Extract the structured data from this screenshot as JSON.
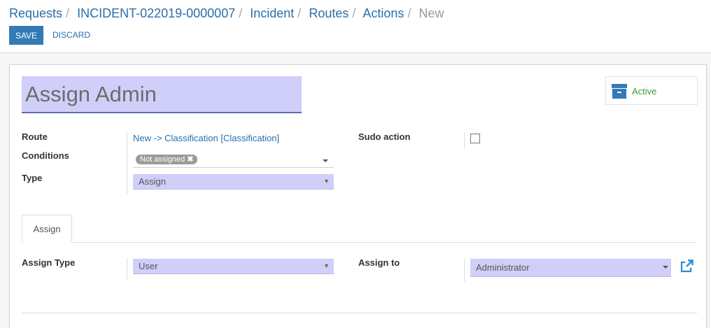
{
  "breadcrumb": {
    "items": [
      "Requests",
      "INCIDENT-022019-0000007",
      "Incident",
      "Routes",
      "Actions"
    ],
    "current": "New"
  },
  "toolbar": {
    "save_label": "SAVE",
    "discard_label": "DISCARD"
  },
  "record": {
    "title": "Assign Admin",
    "active_label": "Active",
    "active_icon": "archive-icon"
  },
  "fields": {
    "route": {
      "label": "Route",
      "value": "New -> Classification [Classification]"
    },
    "conditions": {
      "label": "Conditions",
      "tags": [
        "Not assigned"
      ]
    },
    "type": {
      "label": "Type",
      "value": "Assign"
    },
    "sudo_action": {
      "label": "Sudo action",
      "checked": false
    }
  },
  "tabs": [
    {
      "label": "Assign",
      "active": true
    }
  ],
  "assign_tab": {
    "assign_type": {
      "label": "Assign Type",
      "value": "User"
    },
    "assign_to": {
      "label": "Assign to",
      "value": "Administrator",
      "link_icon": "external-link-icon"
    }
  },
  "colors": {
    "primary": "#337ab7",
    "link": "#2a6fa8",
    "field_bg": "#cfcff9",
    "active": "#3c9b3c"
  }
}
